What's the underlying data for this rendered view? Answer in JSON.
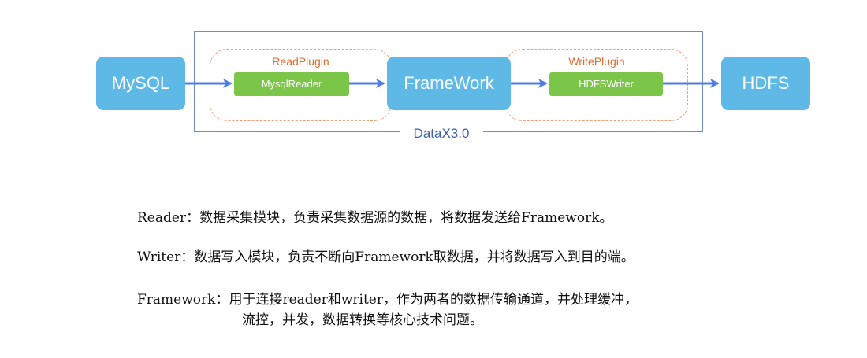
{
  "diagram": {
    "source": "MySQL",
    "framework": "FrameWork",
    "target": "HDFS",
    "read_plugin_title": "ReadPlugin",
    "read_plugin_name": "MysqlReader",
    "write_plugin_title": "WritePlugin",
    "write_plugin_name": "HDFSWriter",
    "container_label": "DataX3.0",
    "colors": {
      "node_blue": "#5eb9e7",
      "plugin_green": "#7bc548",
      "arrow_blue": "#4f7fe0",
      "dashed_orange": "#eea07a",
      "plugin_title_orange": "#e06a2c",
      "frame_blue": "#6d8fc4",
      "label_blue": "#3d63a8"
    }
  },
  "descriptions": {
    "reader": "Reader：数据采集模块，负责采集数据源的数据，将数据发送给Framework。",
    "writer": "Writer：数据写入模块，负责不断向Framework取数据，并将数据写入到目的端。",
    "framework_line1": "Framework：用于连接reader和writer，作为两者的数据传输通道，并处理缓冲，",
    "framework_line2": "流控，并发，数据转换等核心技术问题。"
  }
}
